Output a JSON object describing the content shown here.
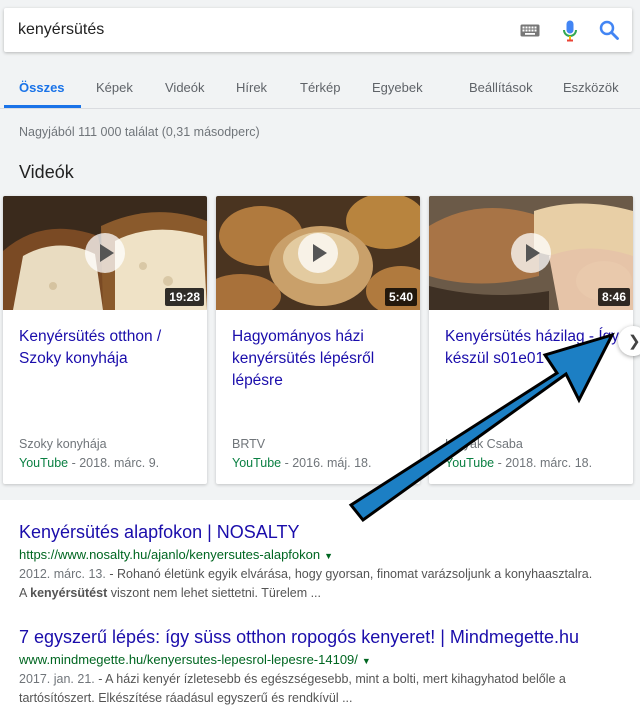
{
  "search": {
    "query": "kenyérsütés"
  },
  "tabs": [
    "Összes",
    "Képek",
    "Videók",
    "Hírek",
    "Térkép",
    "Egyebek",
    "Beállítások",
    "Eszközök"
  ],
  "result_stats": "Nagyjából 111 000 találat (0,31 másodperc)",
  "videos_heading": "Videók",
  "videos": [
    {
      "title": "Kenyérsütés otthon / Szoky konyhája",
      "duration": "19:28",
      "source": "Szoky konyhája",
      "platform": "YouTube",
      "date": " - 2018. márc. 9."
    },
    {
      "title": "Hagyományos házi kenyérsütés lépésről lépésre",
      "duration": "5:40",
      "source": "BRTV",
      "platform": "YouTube",
      "date": " - 2016. máj. 18."
    },
    {
      "title": "Kenyérsütés házilag - Így készül s01e01",
      "duration": "8:46",
      "source": "Holyak Csaba",
      "platform": "YouTube",
      "date": " - 2018. márc. 18."
    }
  ],
  "results": [
    {
      "title": "Kenyérsütés alapfokon | NOSALTY",
      "url": "https://www.nosalty.hu/ajanlo/kenyersutes-alapfokon",
      "date": "2012. márc. 13.",
      "snippet_1": " - Rohanó életünk egyik elvárása, hogy gyorsan, finomat varázsoljunk a konyhaasztalra.",
      "snippet_2_pre": "A ",
      "snippet_2_bold": "kenyérsütést",
      "snippet_2_post": " viszont nem lehet siettetni. Türelem ..."
    },
    {
      "title": "7 egyszerű lépés: így süss otthon ropogós kenyeret! | Mindmegette.hu",
      "url": "www.mindmegette.hu/kenyersutes-lepesrol-lepesre-14109/",
      "date": "2017. jan. 21.",
      "snippet_1": " - A házi kenyér ízletesebb és egészségesebb, mint a bolti, mert kihagyhatod belőle a",
      "snippet_2": "tartósítószert. Elkészítése ráadásul egyszerű és rendkívül ..."
    }
  ],
  "colors": {
    "link": "#1a0dab",
    "url": "#006621",
    "accent": "#1a73e8",
    "annotation_arrow": "#1c7fc4"
  },
  "icons": [
    "keyboard-icon",
    "microphone-icon",
    "search-icon",
    "play-icon",
    "chevron-right-icon"
  ]
}
